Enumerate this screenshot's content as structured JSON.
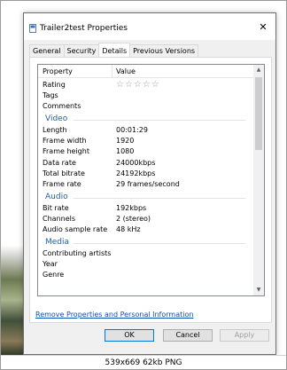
{
  "window": {
    "title": "Trailer2test Properties",
    "close_glyph": "✕"
  },
  "tabs": [
    {
      "label": "General"
    },
    {
      "label": "Security"
    },
    {
      "label": "Details"
    },
    {
      "label": "Previous Versions"
    }
  ],
  "list": {
    "header": {
      "property": "Property",
      "value": "Value"
    },
    "rows": [
      {
        "kind": "item",
        "property": "Rating",
        "stars": "☆☆☆☆☆"
      },
      {
        "kind": "item",
        "property": "Tags",
        "value": ""
      },
      {
        "kind": "item",
        "property": "Comments",
        "value": ""
      },
      {
        "kind": "group",
        "name": "Video"
      },
      {
        "kind": "item",
        "property": "Length",
        "value": "00:01:29"
      },
      {
        "kind": "item",
        "property": "Frame width",
        "value": "1920"
      },
      {
        "kind": "item",
        "property": "Frame height",
        "value": "1080"
      },
      {
        "kind": "item",
        "property": "Data rate",
        "value": "24000kbps"
      },
      {
        "kind": "item",
        "property": "Total bitrate",
        "value": "24192kbps"
      },
      {
        "kind": "item",
        "property": "Frame rate",
        "value": "29 frames/second"
      },
      {
        "kind": "group",
        "name": "Audio"
      },
      {
        "kind": "item",
        "property": "Bit rate",
        "value": "192kbps"
      },
      {
        "kind": "item",
        "property": "Channels",
        "value": "2 (stereo)"
      },
      {
        "kind": "item",
        "property": "Audio sample rate",
        "value": "48 kHz"
      },
      {
        "kind": "group",
        "name": "Media"
      },
      {
        "kind": "item",
        "property": "Contributing artists",
        "value": ""
      },
      {
        "kind": "item",
        "property": "Year",
        "value": ""
      },
      {
        "kind": "item",
        "property": "Genre",
        "value": ""
      }
    ]
  },
  "remove_link": "Remove Properties and Personal Information",
  "buttons": {
    "ok": "OK",
    "cancel": "Cancel",
    "apply": "Apply"
  },
  "footer": "539x669 62kb PNG",
  "colors": {
    "group_heading": "#1e5fa8",
    "link": "#0a4fb0"
  }
}
